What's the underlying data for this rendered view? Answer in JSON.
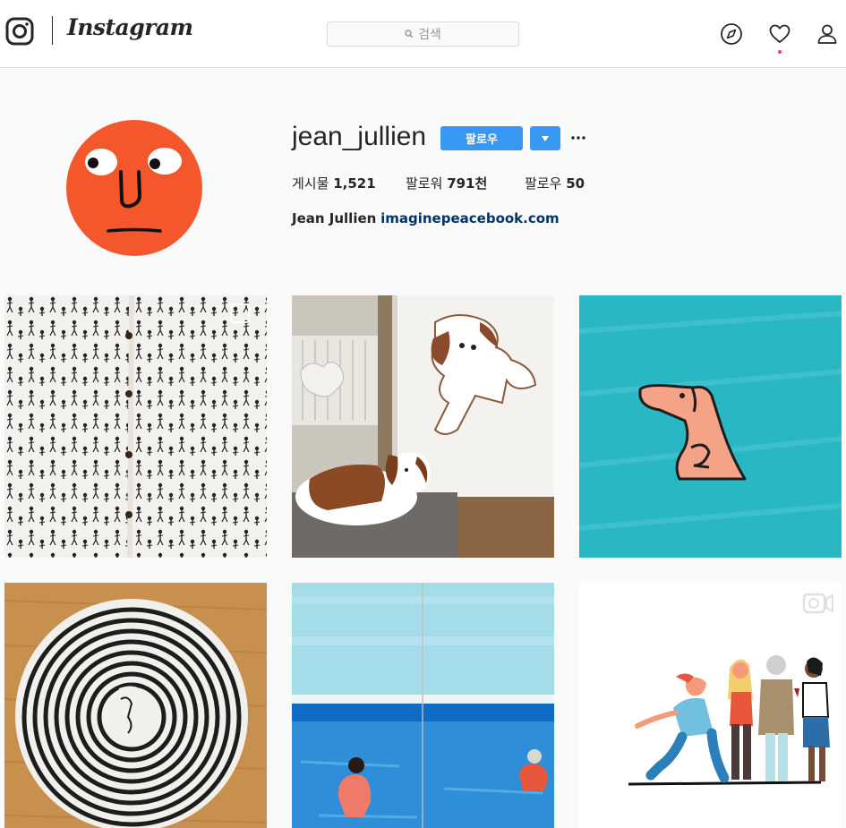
{
  "nav": {
    "wordmark": "Instagram",
    "search_placeholder": "검색",
    "icons": [
      "instagram-logo-icon",
      "compass-icon",
      "heart-icon",
      "user-icon"
    ]
  },
  "profile": {
    "username": "jean_jullien",
    "follow_label": "팔로우",
    "stats": {
      "posts_label": "게시물",
      "posts_value": "1,521",
      "followers_label": "팔로워",
      "followers_value": "791천",
      "following_label": "팔로우",
      "following_value": "50"
    },
    "bio_name": "Jean Jullien",
    "bio_link": "imaginepeacebook.com"
  },
  "colors": {
    "accent": "#3897f0",
    "avatar_orange": "#f4572b",
    "link": "#003569",
    "notification": "#ed4956"
  },
  "posts": [
    {
      "subject": "people-pattern-shirt",
      "type": "carousel"
    },
    {
      "subject": "dog-and-drawing",
      "type": "image"
    },
    {
      "subject": "dog-pin-on-blue",
      "type": "image"
    },
    {
      "subject": "spiral-plate",
      "type": "image"
    },
    {
      "subject": "swimmers-painting",
      "type": "image"
    },
    {
      "subject": "people-illustration",
      "type": "video"
    }
  ]
}
